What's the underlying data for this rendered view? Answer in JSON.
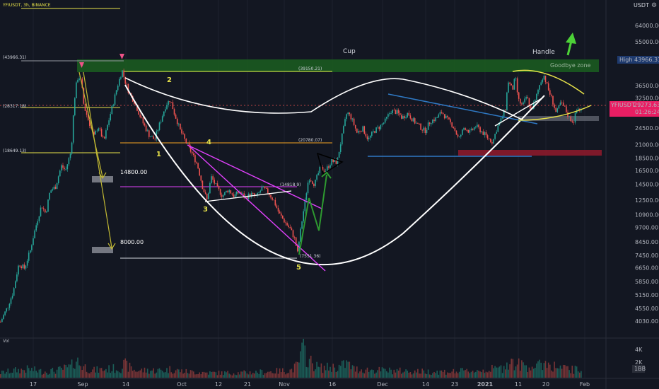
{
  "header": {
    "symbol": "YFIUSDT, 3h, BINANCE",
    "currency": "USDT",
    "settings_glyph": "⚙"
  },
  "chart_data": {
    "type": "candlestick",
    "x_ticks": [
      "17",
      "Sep",
      "14",
      "Oct",
      "12",
      "21",
      "Nov",
      "16",
      "Dec",
      "14",
      "23",
      "2021",
      "11",
      "20",
      "Feb"
    ],
    "y_ticks": [
      "64000.00",
      "55000.00",
      "46000.00",
      "36500.00",
      "32500.00",
      "28500.00",
      "24500.00",
      "21000.00",
      "18500.00",
      "16500.00",
      "14500.00",
      "12500.00",
      "10900.00",
      "9700.00",
      "8450.00",
      "7450.00",
      "6650.00",
      "5850.00",
      "5150.00",
      "4550.00",
      "4030.00"
    ],
    "volume_ticks": [
      "4K",
      "2K",
      "1BB"
    ],
    "volume_label": "Vol",
    "price_path": [
      [
        0,
        4000
      ],
      [
        10,
        4600
      ],
      [
        18,
        5300
      ],
      [
        26,
        6900
      ],
      [
        34,
        6600
      ],
      [
        42,
        7800
      ],
      [
        50,
        9800
      ],
      [
        58,
        11900
      ],
      [
        64,
        11000
      ],
      [
        70,
        13600
      ],
      [
        78,
        14200
      ],
      [
        86,
        17200
      ],
      [
        92,
        16500
      ],
      [
        100,
        19800
      ],
      [
        106,
        35500
      ],
      [
        110,
        40000
      ],
      [
        114,
        38000
      ],
      [
        118,
        30000
      ],
      [
        124,
        26500
      ],
      [
        132,
        22500
      ],
      [
        138,
        25000
      ],
      [
        146,
        21500
      ],
      [
        154,
        27000
      ],
      [
        160,
        31500
      ],
      [
        166,
        37000
      ],
      [
        172,
        42000
      ],
      [
        176,
        38000
      ],
      [
        182,
        34000
      ],
      [
        190,
        31000
      ],
      [
        196,
        28000
      ],
      [
        202,
        25500
      ],
      [
        210,
        23000
      ],
      [
        218,
        22000
      ],
      [
        226,
        26000
      ],
      [
        234,
        30500
      ],
      [
        240,
        32000
      ],
      [
        246,
        28000
      ],
      [
        254,
        24000
      ],
      [
        262,
        21500
      ],
      [
        270,
        19500
      ],
      [
        278,
        17500
      ],
      [
        286,
        14000
      ],
      [
        292,
        12500
      ],
      [
        298,
        15500
      ],
      [
        306,
        14000
      ],
      [
        314,
        13000
      ],
      [
        322,
        13800
      ],
      [
        330,
        13000
      ],
      [
        338,
        13500
      ],
      [
        346,
        12800
      ],
      [
        354,
        13200
      ],
      [
        362,
        12900
      ],
      [
        370,
        14000
      ],
      [
        378,
        13500
      ],
      [
        386,
        12500
      ],
      [
        394,
        11000
      ],
      [
        402,
        10200
      ],
      [
        410,
        9500
      ],
      [
        416,
        8700
      ],
      [
        420,
        7600
      ],
      [
        424,
        9300
      ],
      [
        430,
        12000
      ],
      [
        436,
        15500
      ],
      [
        444,
        14500
      ],
      [
        452,
        16800
      ],
      [
        460,
        16500
      ],
      [
        468,
        18000
      ],
      [
        476,
        17800
      ],
      [
        484,
        23500
      ],
      [
        490,
        28500
      ],
      [
        496,
        27000
      ],
      [
        504,
        23500
      ],
      [
        512,
        24500
      ],
      [
        520,
        22000
      ],
      [
        528,
        23800
      ],
      [
        536,
        24800
      ],
      [
        544,
        26200
      ],
      [
        552,
        28800
      ],
      [
        560,
        28500
      ],
      [
        568,
        27000
      ],
      [
        576,
        28200
      ],
      [
        584,
        26200
      ],
      [
        592,
        25000
      ],
      [
        600,
        23800
      ],
      [
        608,
        26200
      ],
      [
        616,
        26800
      ],
      [
        624,
        28500
      ],
      [
        632,
        26500
      ],
      [
        640,
        25000
      ],
      [
        648,
        22000
      ],
      [
        656,
        24800
      ],
      [
        664,
        23500
      ],
      [
        672,
        25000
      ],
      [
        680,
        23800
      ],
      [
        688,
        22500
      ],
      [
        696,
        21500
      ],
      [
        702,
        24500
      ],
      [
        708,
        26500
      ],
      [
        714,
        29500
      ],
      [
        718,
        38000
      ],
      [
        724,
        35000
      ],
      [
        728,
        39500
      ],
      [
        732,
        32000
      ],
      [
        738,
        30000
      ],
      [
        744,
        33000
      ],
      [
        750,
        29000
      ],
      [
        756,
        31500
      ],
      [
        762,
        36500
      ],
      [
        768,
        40500
      ],
      [
        774,
        35500
      ],
      [
        780,
        32000
      ],
      [
        786,
        28000
      ],
      [
        792,
        31000
      ],
      [
        798,
        29500
      ],
      [
        804,
        27000
      ],
      [
        810,
        26000
      ],
      [
        816,
        29500
      ],
      [
        822,
        28800
      ]
    ],
    "volume_path": [
      [
        0,
        0.2
      ],
      [
        20,
        0.3
      ],
      [
        40,
        0.35
      ],
      [
        60,
        0.25
      ],
      [
        80,
        0.3
      ],
      [
        100,
        0.45
      ],
      [
        106,
        0.8
      ],
      [
        112,
        0.55
      ],
      [
        130,
        0.3
      ],
      [
        150,
        0.35
      ],
      [
        170,
        0.4
      ],
      [
        175,
        0.55
      ],
      [
        190,
        0.3
      ],
      [
        230,
        0.3
      ],
      [
        240,
        0.35
      ],
      [
        260,
        0.25
      ],
      [
        300,
        0.2
      ],
      [
        340,
        0.2
      ],
      [
        380,
        0.25
      ],
      [
        410,
        0.3
      ],
      [
        420,
        0.5
      ],
      [
        428,
        1.2
      ],
      [
        432,
        0.95
      ],
      [
        436,
        0.7
      ],
      [
        450,
        0.4
      ],
      [
        480,
        0.45
      ],
      [
        490,
        0.6
      ],
      [
        500,
        0.35
      ],
      [
        540,
        0.3
      ],
      [
        600,
        0.25
      ],
      [
        640,
        0.25
      ],
      [
        680,
        0.3
      ],
      [
        710,
        0.4
      ],
      [
        718,
        0.7
      ],
      [
        728,
        0.55
      ],
      [
        760,
        0.45
      ],
      [
        768,
        0.65
      ],
      [
        790,
        0.4
      ],
      [
        822,
        0.3
      ]
    ],
    "levels": [
      {
        "label": "(43966.31)",
        "price": 43966.31
      },
      {
        "label": "(39150.21)",
        "price": 39150.21
      },
      {
        "label": "(28317.18)",
        "price": 28317.18
      },
      {
        "label": "(20780.07)",
        "price": 20780.07
      },
      {
        "label": "(18649.13)",
        "price": 18649.13
      },
      {
        "label": "(14818.9)",
        "price": 14818.9
      },
      {
        "label": "(7551.36)",
        "price": 7551.36
      }
    ],
    "annotations": {
      "cup": "Cup",
      "handle": "Handle",
      "goodbye_zone": "Goodbye zone",
      "wave": [
        "1",
        "2",
        "3",
        "4",
        "5"
      ],
      "target_1": "14800.00",
      "target_2": "8000.00"
    },
    "price_labels": {
      "high_label": "High",
      "high_value": "43966.31",
      "symbol_tag": "YFIUSDT",
      "last_price": "29273.63",
      "countdown": "01:26:24"
    },
    "colors": {
      "background": "#131722",
      "candle_up": "#26a69a",
      "candle_down": "#ef5350",
      "green_zone": "#1b5e20",
      "red_zone": "#8b1a2b",
      "pink_channel": "#e040fb",
      "blue_line": "#2f79c4",
      "yellow": "#e8e34a",
      "white_curve": "#ffffff",
      "orange_level": "#f5a623"
    }
  }
}
